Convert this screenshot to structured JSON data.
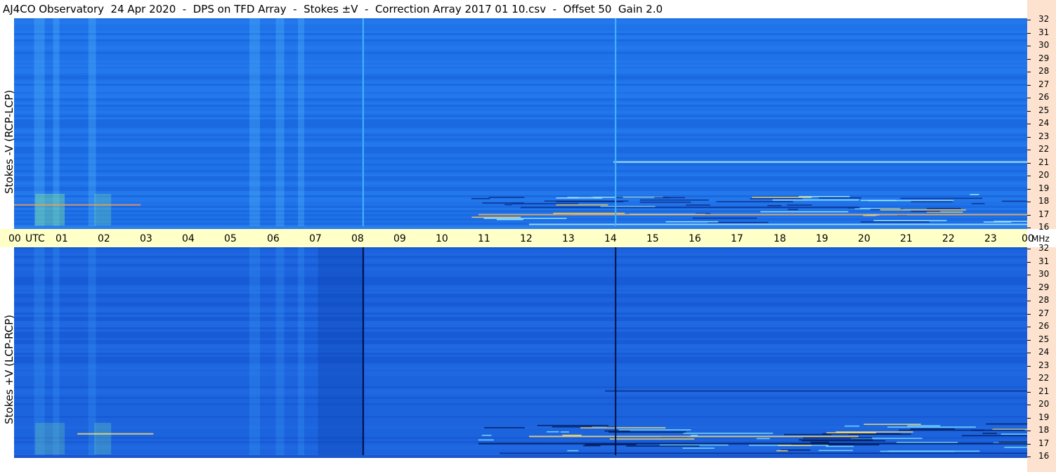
{
  "title": "AJ4CO Observatory  24 Apr 2020  -  DPS on TFD Array  -  Stokes ±V  -  Correction Array 2017 01 10.csv  -  Offset 50  Gain 2.0",
  "colors": {
    "background": "#1c6ee6",
    "highlight": "#a0e8ff",
    "utc_bar": "#ffffc8",
    "freq_column": "#fde3cf"
  },
  "chart_data": [
    {
      "type": "heatmap",
      "ylabel": "Stokes -V (RCP-LCP)",
      "y_unit": "MHz",
      "ylim": [
        16,
        32
      ],
      "y_ticks": [
        "32",
        "31",
        "30",
        "29",
        "28",
        "27",
        "26",
        "25",
        "24",
        "23",
        "22",
        "21",
        "20",
        "19",
        "18",
        "17",
        "16"
      ],
      "xlim": [
        0,
        24
      ],
      "features": [
        {
          "kind": "vertical_line",
          "utc_hour": 8.27,
          "color": "#45b6ff"
        },
        {
          "kind": "vertical_line",
          "utc_hour": 14.25,
          "color": "#45b6ff"
        }
      ]
    },
    {
      "type": "heatmap",
      "ylabel": "Stokes +V (LCP-RCP)",
      "y_unit": "MHz",
      "ylim": [
        16,
        32
      ],
      "y_ticks": [
        "32",
        "31",
        "30",
        "29",
        "28",
        "27",
        "26",
        "25",
        "24",
        "23",
        "22",
        "21",
        "20",
        "19",
        "18",
        "17",
        "16"
      ],
      "xlim": [
        0,
        24
      ],
      "features": [
        {
          "kind": "vertical_line",
          "utc_hour": 8.27,
          "color": "#001040"
        },
        {
          "kind": "vertical_line",
          "utc_hour": 14.25,
          "color": "#001040"
        }
      ]
    }
  ],
  "x_axis": {
    "labels": [
      "00",
      "UTC",
      "01",
      "02",
      "03",
      "04",
      "05",
      "06",
      "07",
      "08",
      "09",
      "10",
      "11",
      "12",
      "13",
      "14",
      "15",
      "16",
      "17",
      "18",
      "19",
      "20",
      "21",
      "22",
      "23",
      "00",
      "MHz"
    ]
  }
}
